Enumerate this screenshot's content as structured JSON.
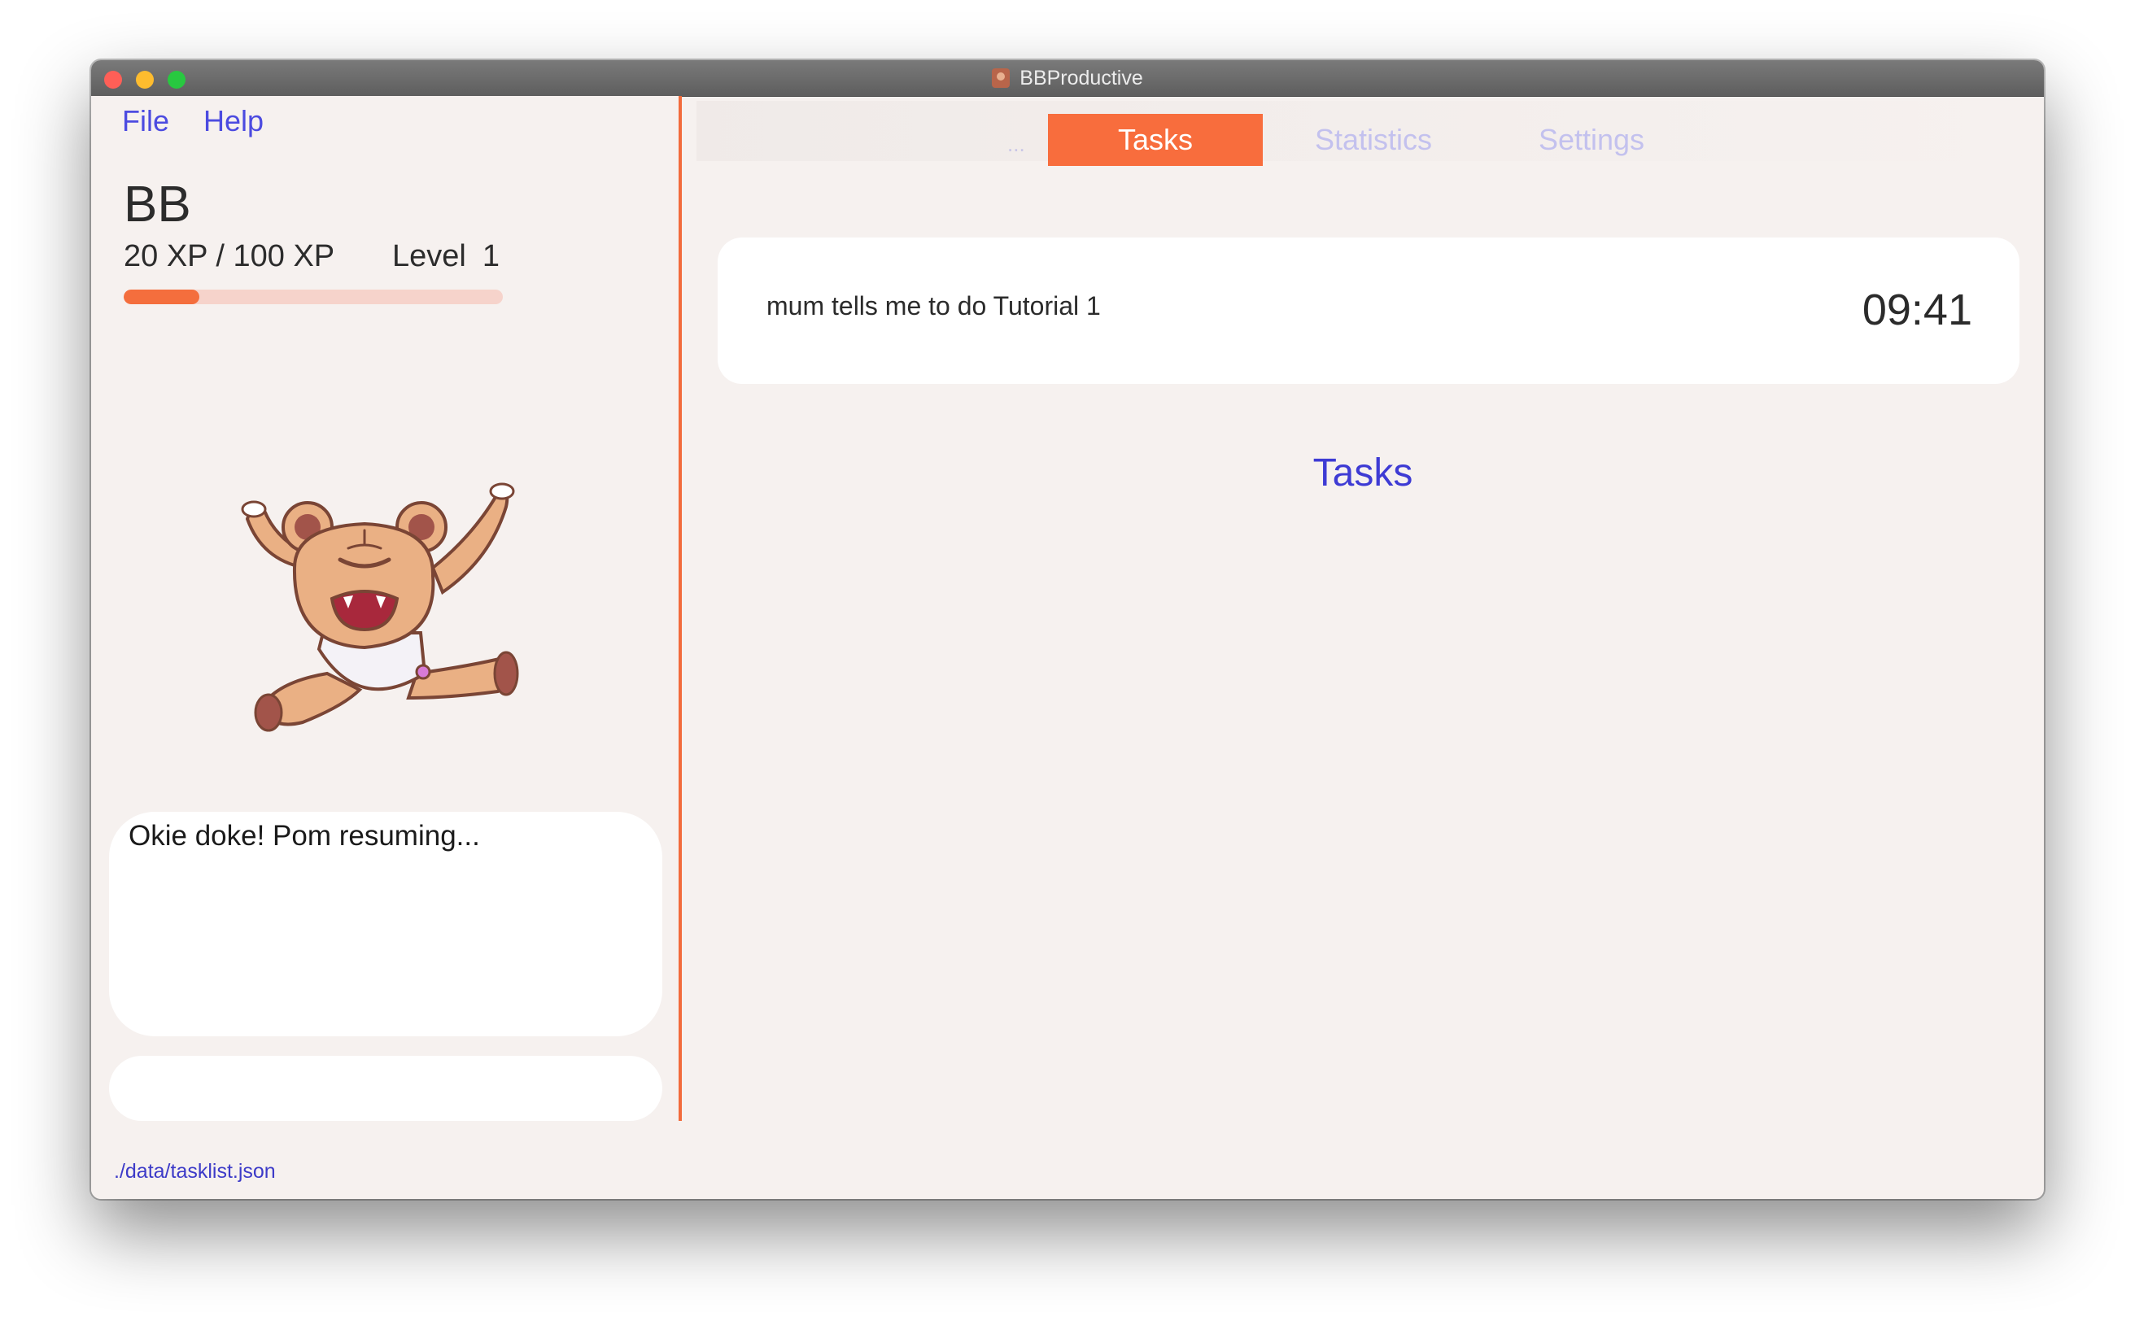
{
  "window": {
    "title": "BBProductive"
  },
  "menu": {
    "file": "File",
    "help": "Help"
  },
  "pet": {
    "name": "BB",
    "xp_text": "20 XP / 100 XP",
    "level_label": "Level",
    "level_value": "1",
    "xp_progress": 0.2,
    "message": "Okie doke! Pom resuming..."
  },
  "command": {
    "value": "",
    "placeholder": ""
  },
  "status": {
    "path": "./data/tasklist.json"
  },
  "tabs": {
    "ellipsis": "...",
    "items": [
      {
        "label": "Tasks",
        "active": true
      },
      {
        "label": "Statistics",
        "active": false
      },
      {
        "label": "Settings",
        "active": false
      }
    ]
  },
  "pomodoro": {
    "task_name": "mum tells me to do Tutorial 1",
    "timer": "09:41"
  },
  "main": {
    "section_title": "Tasks"
  },
  "colors": {
    "accent": "#f86d3d",
    "link": "#4c4be0",
    "tab_inactive": "#c3c1ee",
    "background": "#f6f1ef"
  }
}
